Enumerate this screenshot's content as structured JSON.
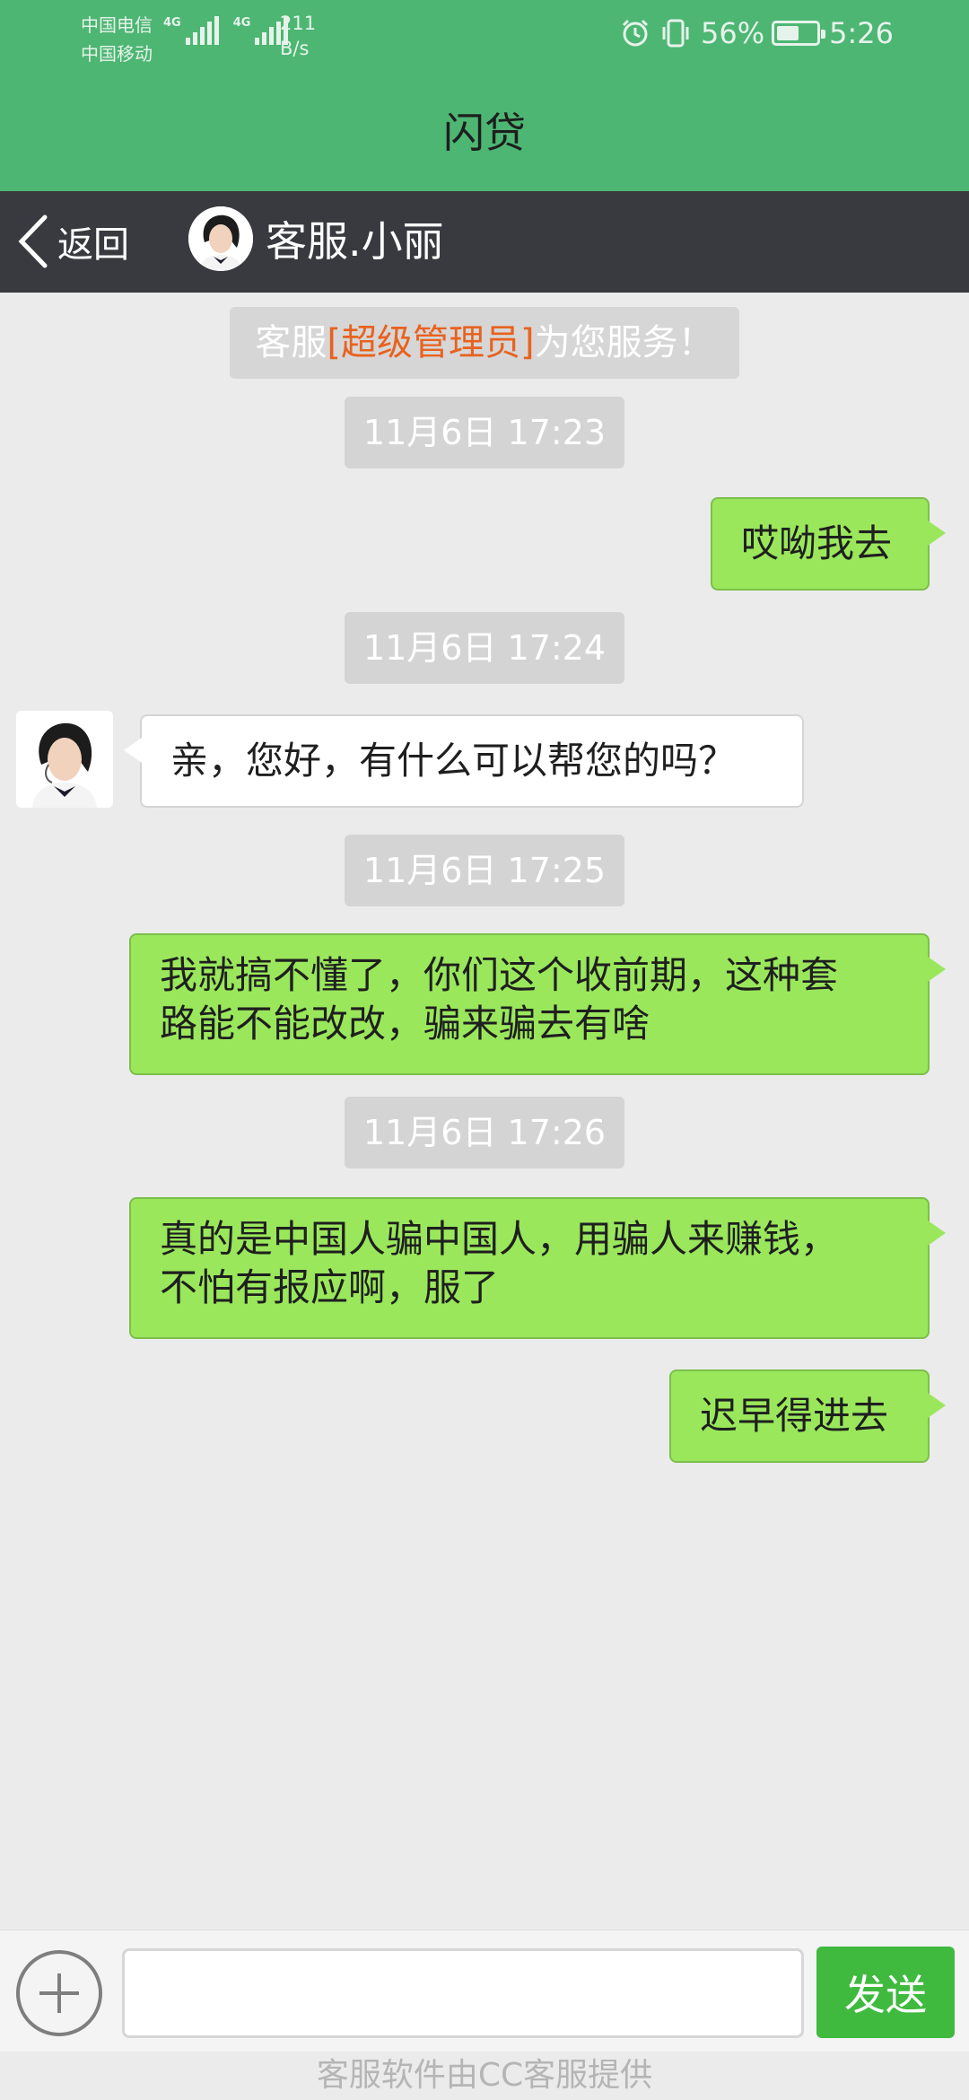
{
  "status_bar": {
    "carrier1": "中国电信",
    "carrier2": "中国移动",
    "net_tag1": "4G",
    "net_tag2": "4G",
    "speed_value": "211",
    "speed_unit": "B/s",
    "battery_label": "56%",
    "battery_level": 0.56,
    "time": "5:26",
    "icons": [
      "alarm-icon",
      "vibrate-icon",
      "battery-icon"
    ]
  },
  "app": {
    "title": "闪贷"
  },
  "nav": {
    "back_label": "返回",
    "agent_name": "客服.小丽"
  },
  "chat": {
    "notice_prefix": "客服",
    "notice_highlight": "[超级管理员]",
    "notice_suffix": "为您服务！",
    "timestamps": [
      "11月6日 17:23",
      "11月6日 17:24",
      "11月6日 17:25",
      "11月6日 17:26"
    ],
    "messages": [
      {
        "from": "me",
        "text": "哎呦我去"
      },
      {
        "from": "agent",
        "text": "亲，您好，有什么可以帮您的吗？"
      },
      {
        "from": "me",
        "line1": "我就搞不懂了，你们这个收前期，这种套",
        "line2": "路能不能改改，骗来骗去有啥"
      },
      {
        "from": "me",
        "line1": "真的是中国人骗中国人，用骗人来赚钱，",
        "line2": "不怕有报应啊，服了"
      },
      {
        "from": "me",
        "text": "迟早得进去"
      }
    ]
  },
  "input_bar": {
    "placeholder": "",
    "value": "",
    "send_label": "发送"
  },
  "footer": {
    "text": "客服软件由CC客服提供"
  },
  "colors": {
    "header": "#4db673",
    "nav": "#393a3f",
    "my_bubble": "#9ae75c",
    "send_button": "#3fba3f",
    "highlight": "#e8621f"
  }
}
